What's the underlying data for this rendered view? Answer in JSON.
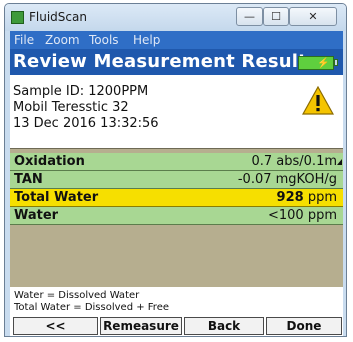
{
  "window": {
    "title": "FluidScan",
    "controls": {
      "minimize": "—",
      "maximize": "☐",
      "close": "✕"
    }
  },
  "menu": {
    "file": "File",
    "zoom": "Zoom",
    "tools": "Tools",
    "help": "Help"
  },
  "header": {
    "title": "Review Measurement Results",
    "battery_plug": "⚡"
  },
  "sample": {
    "id_line": "Sample ID: 1200PPM",
    "name": "Mobil Teresstic 32",
    "datetime": "13 Dec 2016 13:32:56",
    "warning_icon": "warning-triangle"
  },
  "results": [
    {
      "label": "Oxidation",
      "value": "0.7 abs/0.1m",
      "highlight": false
    },
    {
      "label": "TAN",
      "value": "-0.07 mgKOH/g",
      "highlight": false
    },
    {
      "label": "Total Water",
      "value_number": "928",
      "value_unit": "ppm",
      "highlight": true
    },
    {
      "label": "Water",
      "value": "<100 ppm",
      "highlight": false
    }
  ],
  "legend": {
    "line1": "Water = Dissolved Water",
    "line2": "Total Water = Dissolved + Free"
  },
  "buttons": {
    "prev": "<<",
    "remeasure": "Remeasure",
    "back": "Back",
    "done": "Done"
  },
  "colors": {
    "header_bg": "#1f58ad",
    "row_bg": "#a8d793",
    "highlight_row": "#f6df00",
    "results_bg": "#b6ae8f"
  }
}
